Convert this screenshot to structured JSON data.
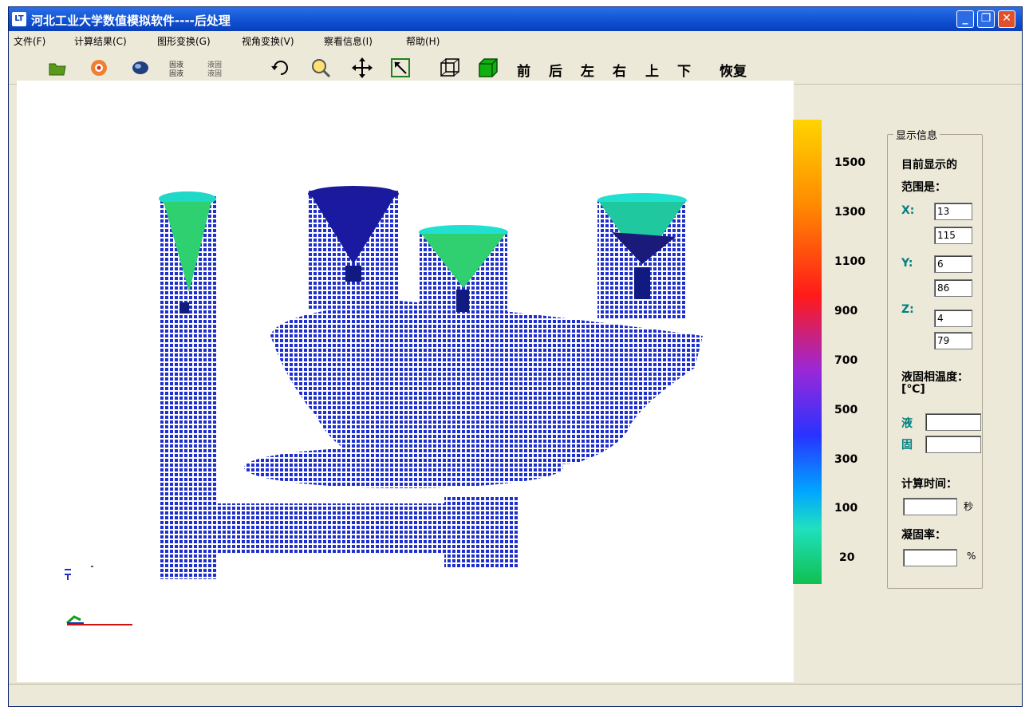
{
  "window": {
    "title": "河北工业大学数值模拟软件----后处理",
    "app_icon": "app-icon"
  },
  "menu": [
    "文件(F)",
    "计算结果(C)",
    "图形变换(G)",
    "视角变换(V)",
    "察看信息(I)",
    "帮助(H)"
  ],
  "toolbar": {
    "icons": [
      "open-folder-icon",
      "render-color-icon",
      "shade-icon",
      "solid-liquid-icon",
      "liquid-solid-icon",
      "rotate-icon",
      "zoom-icon",
      "move-icon",
      "select-box-icon",
      "wireframe-cube-icon",
      "solid-cube-icon"
    ],
    "views": [
      "前",
      "后",
      "左",
      "右",
      "上",
      "下"
    ],
    "restore": "恢复"
  },
  "colors": {
    "title_blue": "#0f4fd0",
    "mesh_blue": "#1f2fcf",
    "axis_teal": "#008080"
  },
  "scale": {
    "labels": [
      "1500",
      "1300",
      "1100",
      "900",
      "700",
      "500",
      "300",
      "100",
      "20"
    ]
  },
  "panel": {
    "legend": "显示信息",
    "range_title_1": "目前显示的",
    "range_title_2": "范围是：",
    "x_label": "X:",
    "x_min": "13",
    "x_max": "115",
    "y_label": "Y:",
    "y_min": "6",
    "y_max": "86",
    "z_label": "Z:",
    "z_min": "4",
    "z_max": "79",
    "temp_title": "液固相温度：",
    "temp_unit": "[℃]",
    "liquid_label": "液",
    "solid_label": "固",
    "time_title": "计算时间：",
    "time_unit": "秒",
    "solid_fraction_title": "凝固率：",
    "percent_unit": "%"
  }
}
